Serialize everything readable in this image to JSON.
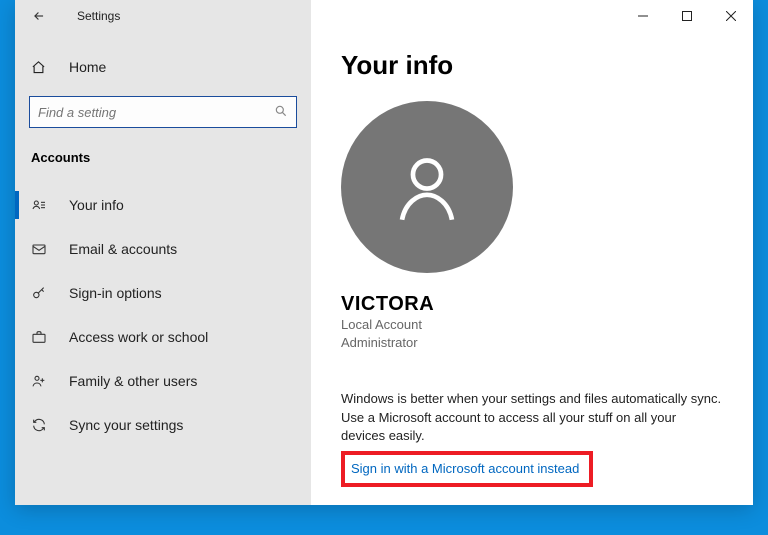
{
  "window": {
    "title": "Settings"
  },
  "search": {
    "placeholder": "Find a setting"
  },
  "section": "Accounts",
  "home_label": "Home",
  "nav": [
    {
      "icon": "user-card-icon",
      "label": "Your info",
      "selected": true
    },
    {
      "icon": "mail-icon",
      "label": "Email & accounts"
    },
    {
      "icon": "key-icon",
      "label": "Sign-in options"
    },
    {
      "icon": "briefcase-icon",
      "label": "Access work or school"
    },
    {
      "icon": "family-icon",
      "label": "Family & other users"
    },
    {
      "icon": "sync-icon",
      "label": "Sync your settings"
    }
  ],
  "page": {
    "heading": "Your info",
    "username": "VICTORA",
    "account_type": "Local Account",
    "account_role": "Administrator",
    "desc": "Windows is better when your settings and files automatically sync. Use a Microsoft account to access all your stuff on all your devices easily.",
    "signin_link": "Sign in with a Microsoft account instead"
  }
}
